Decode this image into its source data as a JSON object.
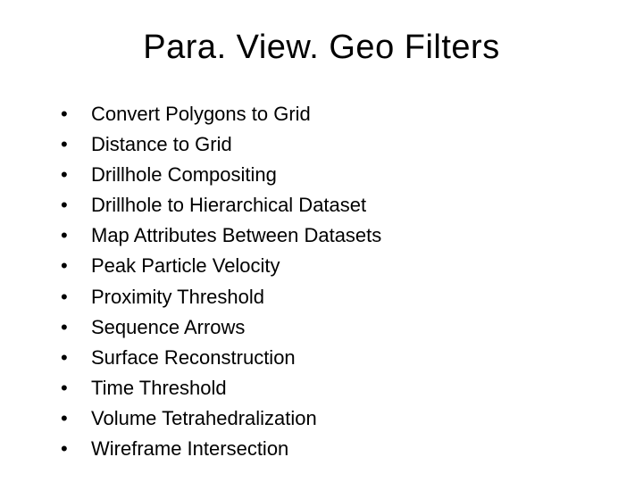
{
  "title": "Para. View. Geo Filters",
  "bullet": "•",
  "items": [
    "Convert Polygons to Grid",
    "Distance to Grid",
    "Drillhole Compositing",
    "Drillhole to Hierarchical Dataset",
    "Map Attributes Between Datasets",
    "Peak Particle Velocity",
    "Proximity Threshold",
    "Sequence Arrows",
    "Surface Reconstruction",
    "Time Threshold",
    "Volume Tetrahedralization",
    "Wireframe Intersection"
  ]
}
